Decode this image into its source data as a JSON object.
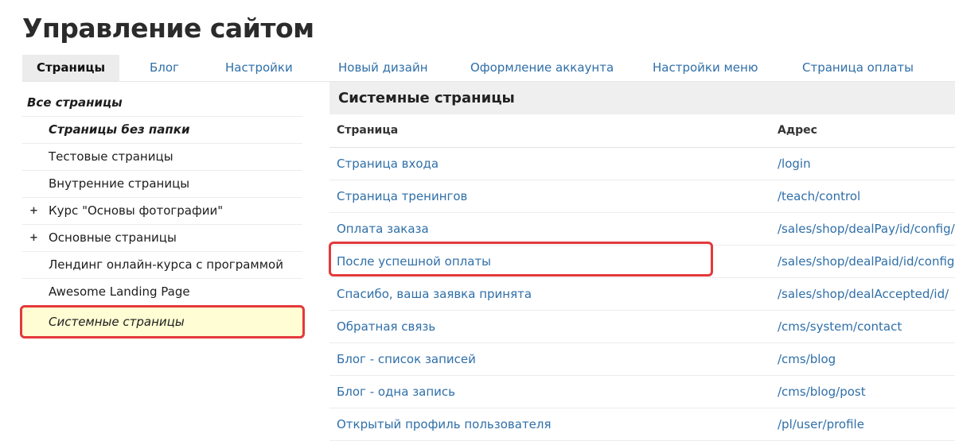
{
  "page": {
    "title": "Управление сайтом"
  },
  "tabs": [
    {
      "label": "Страницы",
      "active": true
    },
    {
      "label": "Блог"
    },
    {
      "label": "Настройки"
    },
    {
      "label": "Новый дизайн"
    },
    {
      "label": "Оформление аккаунта"
    },
    {
      "label": "Настройки меню"
    },
    {
      "label": "Страница оплаты"
    }
  ],
  "sidebar": {
    "items": [
      {
        "label": "Все страницы"
      },
      {
        "label": "Страницы без папки"
      },
      {
        "label": "Тестовые страницы"
      },
      {
        "label": "Внутренние страницы"
      },
      {
        "label": "Курс \"Основы фотографии\"",
        "expandable": true,
        "expand_symbol": "+"
      },
      {
        "label": "Основные страницы",
        "expandable": true,
        "expand_symbol": "+"
      },
      {
        "label": "Лендинг онлайн-курса с программой"
      },
      {
        "label": "Awesome Landing Page"
      },
      {
        "label": "Системные страницы",
        "selected": true
      }
    ]
  },
  "main": {
    "section_title": "Системные страницы",
    "columns": {
      "page": "Страница",
      "address": "Адрес"
    },
    "rows": [
      {
        "page": "Страница входа",
        "address": "/login"
      },
      {
        "page": "Страница тренингов",
        "address": "/teach/control"
      },
      {
        "page": "Оплата заказа",
        "address": "/sales/shop/dealPay/id/config/"
      },
      {
        "page": "После успешной оплаты",
        "address": "/sales/shop/dealPaid/id/config"
      },
      {
        "page": "Спасибо, ваша заявка принята",
        "address": "/sales/shop/dealAccepted/id/"
      },
      {
        "page": "Обратная связь",
        "address": "/cms/system/contact"
      },
      {
        "page": "Блог - список записей",
        "address": "/cms/blog"
      },
      {
        "page": "Блог - одна запись",
        "address": "/cms/blog/post"
      },
      {
        "page": "Открытый профиль пользователя",
        "address": "/pl/user/profile"
      }
    ]
  },
  "colors": {
    "link": "#2f6fa8",
    "highlight_border": "#e3393a",
    "selected_bg": "#fefdd3",
    "active_tab_bg": "#ececec"
  }
}
